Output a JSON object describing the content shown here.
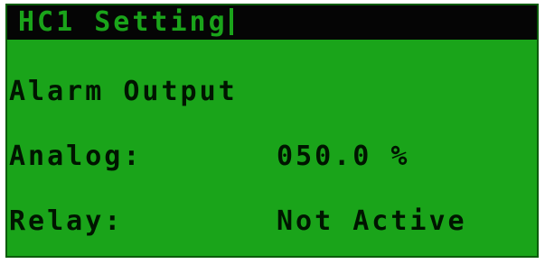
{
  "screen": {
    "title": "HC1 Setting",
    "heading": "Alarm Output",
    "rows": [
      {
        "label": "Analog:",
        "value": "050.0 %"
      },
      {
        "label": "Relay:",
        "value": "Not Active"
      }
    ]
  },
  "colors": {
    "lcd_background": "#1aa41a",
    "lcd_text": "#001500",
    "title_bar": "#050505"
  }
}
